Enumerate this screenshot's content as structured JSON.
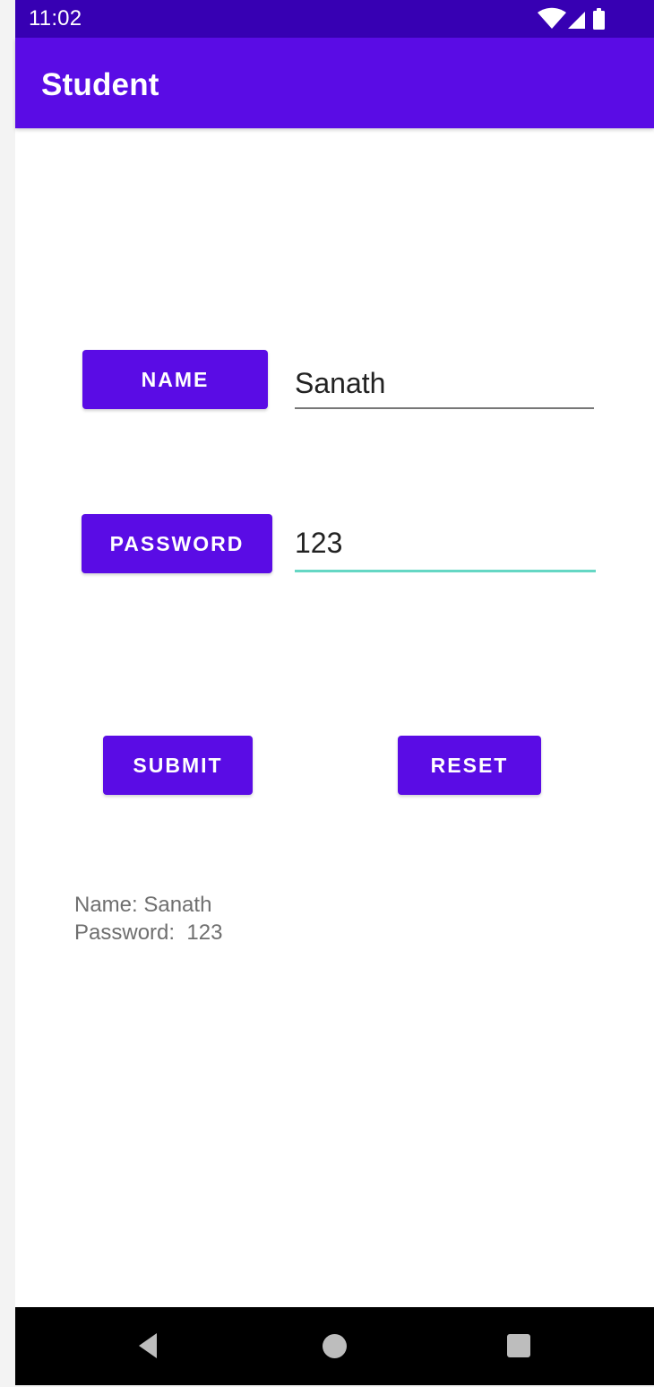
{
  "status_bar": {
    "time": "11:02",
    "icons": [
      "wifi-icon",
      "signal-icon",
      "battery-icon"
    ]
  },
  "app_bar": {
    "title": "Student"
  },
  "form": {
    "name_button_label": "NAME",
    "name_value": "Sanath",
    "password_button_label": "PASSWORD",
    "password_value": "123",
    "submit_label": "SUBMIT",
    "reset_label": "RESET"
  },
  "output": {
    "line1": "Name: Sanath",
    "line2": "Password:  123"
  },
  "nav_bar": {
    "icons": [
      "back-icon",
      "home-icon",
      "recents-icon"
    ]
  },
  "colors": {
    "status_bar": "#3700b3",
    "app_bar": "#5a0ce5",
    "button": "#5a0ce5",
    "focused_underline": "#65d7c4",
    "navigation_bar": "#000000"
  }
}
